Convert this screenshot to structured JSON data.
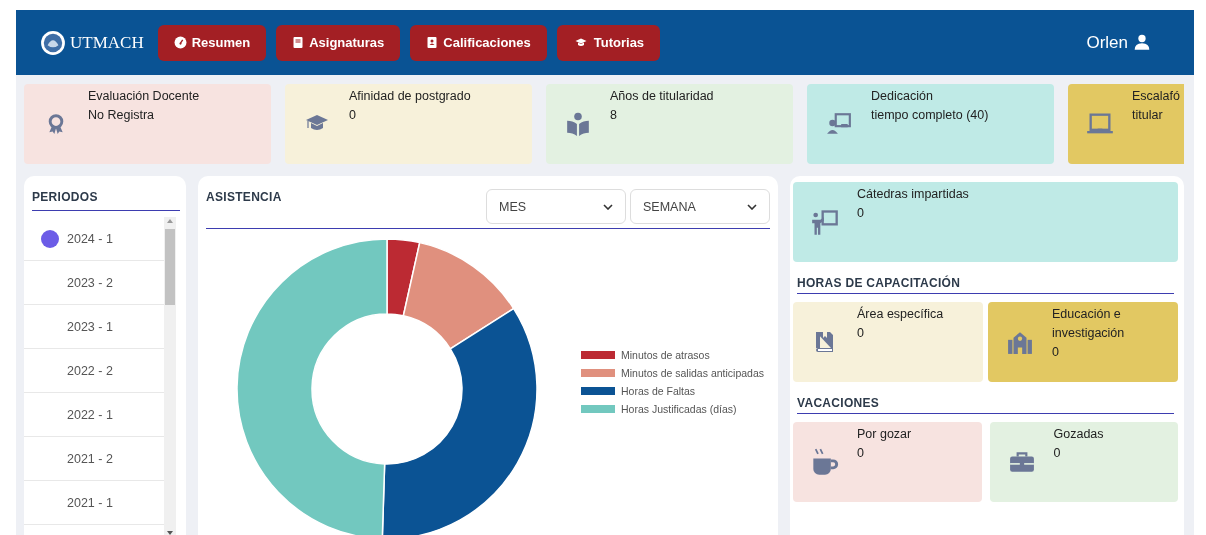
{
  "header": {
    "logo": "UTMACH",
    "nav": [
      {
        "label": "Resumen"
      },
      {
        "label": "Asignaturas"
      },
      {
        "label": "Calificaciones"
      },
      {
        "label": "Tutorias"
      }
    ],
    "user": "Orlen"
  },
  "stat_cards": [
    {
      "title": "Evaluación Docente",
      "value": "No Registra",
      "color": "#f7e3e0"
    },
    {
      "title": "Afinidad de postgrado",
      "value": "0",
      "color": "#f7f1da"
    },
    {
      "title": "Años de titularidad",
      "value": "8",
      "color": "#e3f1e1"
    },
    {
      "title": "Dedicación",
      "value": "tiempo completo (40)",
      "color": "#bfeae6"
    },
    {
      "title": "Escalafó",
      "value": "titular",
      "color": "#e2c862"
    }
  ],
  "periods": {
    "title": "PERIODOS",
    "items": [
      {
        "label": "2024 - 1",
        "selected": true
      },
      {
        "label": "2023 - 2",
        "selected": false
      },
      {
        "label": "2023 - 1",
        "selected": false
      },
      {
        "label": "2022 - 2",
        "selected": false
      },
      {
        "label": "2022 - 1",
        "selected": false
      },
      {
        "label": "2021 - 2",
        "selected": false
      },
      {
        "label": "2021 - 1",
        "selected": false
      }
    ]
  },
  "attendance": {
    "title": "ASISTENCIA",
    "selects": [
      {
        "value": "MES"
      },
      {
        "value": "SEMANA"
      }
    ],
    "legend": [
      {
        "label": "Minutos de atrasos",
        "color": "#bc2a33"
      },
      {
        "label": "Minutos de salidas anticipadas",
        "color": "#e0907e"
      },
      {
        "label": "Horas de Faltas",
        "color": "#0b5394"
      },
      {
        "label": "Horas Justificadas (días)",
        "color": "#72c8bf"
      }
    ]
  },
  "summary": {
    "card": {
      "title": "Cátedras impartidas",
      "value": "0",
      "color": "#bfeae6"
    },
    "sections": [
      {
        "title": "HORAS DE CAPACITACIÓN",
        "cards": [
          {
            "title": "Área específica",
            "value": "0",
            "color": "#f7f1da"
          },
          {
            "title": "Educación e investigación",
            "value": "0",
            "color": "#e2c862"
          }
        ]
      },
      {
        "title": "VACACIONES",
        "cards": [
          {
            "title": "Por gozar",
            "value": "0",
            "color": "#f7e3e0"
          },
          {
            "title": "Gozadas",
            "value": "0",
            "color": "#e3f1e1"
          }
        ]
      }
    ]
  }
}
